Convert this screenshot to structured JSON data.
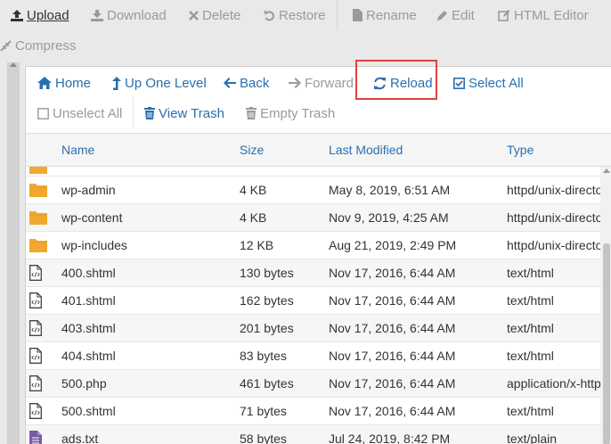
{
  "toolbar": {
    "upload": "Upload",
    "download": "Download",
    "delete": "Delete",
    "restore": "Restore",
    "rename": "Rename",
    "edit": "Edit",
    "html_editor": "HTML Editor",
    "compress": "Compress"
  },
  "nav": {
    "home": "Home",
    "up_one_level": "Up One Level",
    "back": "Back",
    "forward": "Forward",
    "reload": "Reload",
    "select_all": "Select All",
    "unselect_all": "Unselect All",
    "view_trash": "View Trash",
    "empty_trash": "Empty Trash"
  },
  "table": {
    "headers": {
      "name": "Name",
      "size": "Size",
      "modified": "Last Modified",
      "type": "Type"
    },
    "rows": [
      {
        "icon": "folder-icon",
        "name": "wp-admin",
        "size": "4 KB",
        "modified": "May 8, 2019, 6:51 AM",
        "type": "httpd/unix-directory"
      },
      {
        "icon": "folder-icon",
        "name": "wp-content",
        "size": "4 KB",
        "modified": "Nov 9, 2019, 4:25 AM",
        "type": "httpd/unix-directory"
      },
      {
        "icon": "folder-icon",
        "name": "wp-includes",
        "size": "12 KB",
        "modified": "Aug 21, 2019, 2:49 PM",
        "type": "httpd/unix-directory"
      },
      {
        "icon": "code-file-icon",
        "name": "400.shtml",
        "size": "130 bytes",
        "modified": "Nov 17, 2016, 6:44 AM",
        "type": "text/html"
      },
      {
        "icon": "code-file-icon",
        "name": "401.shtml",
        "size": "162 bytes",
        "modified": "Nov 17, 2016, 6:44 AM",
        "type": "text/html"
      },
      {
        "icon": "code-file-icon",
        "name": "403.shtml",
        "size": "201 bytes",
        "modified": "Nov 17, 2016, 6:44 AM",
        "type": "text/html"
      },
      {
        "icon": "code-file-icon",
        "name": "404.shtml",
        "size": "83 bytes",
        "modified": "Nov 17, 2016, 6:44 AM",
        "type": "text/html"
      },
      {
        "icon": "code-file-icon",
        "name": "500.php",
        "size": "461 bytes",
        "modified": "Nov 17, 2016, 6:44 AM",
        "type": "application/x-httpd-php"
      },
      {
        "icon": "code-file-icon",
        "name": "500.shtml",
        "size": "71 bytes",
        "modified": "Nov 17, 2016, 6:44 AM",
        "type": "text/html"
      },
      {
        "icon": "text-file-icon",
        "name": "ads.txt",
        "size": "58 bytes",
        "modified": "Jul 24, 2019, 8:42 PM",
        "type": "text/plain"
      }
    ]
  },
  "colors": {
    "link": "#2a6fb0",
    "disabled": "#9a9a9a",
    "folder": "#f0a830",
    "text_file": "#7a5aa8",
    "highlight_border": "#e04141"
  }
}
